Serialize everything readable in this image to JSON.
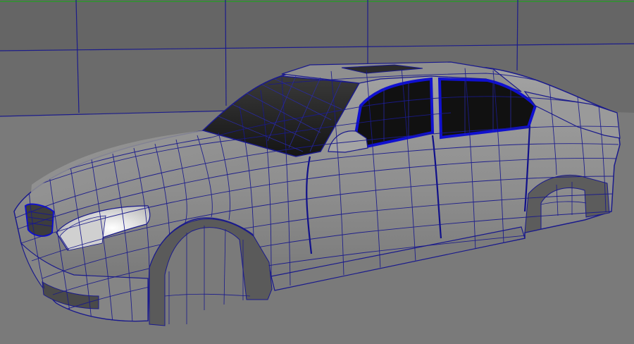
{
  "viewport": {
    "kind": "3d-modeling-viewport",
    "subject": "car-body-wireframe-mesh",
    "shading": "smooth-shaded-with-wireframe-on",
    "colors": {
      "background": "#6f6f6f",
      "floor": "#7b7b7b",
      "back_wall": "#6a6a6a",
      "grid_lines": "#1c1c8a",
      "mesh_wire": "#1a1a8c",
      "body_shade": "#909090",
      "glass": "#1a1a1a",
      "selected_edge": "#1010d0",
      "headlight": "#f2f2f2",
      "top_border": "#3a8a3a"
    }
  }
}
